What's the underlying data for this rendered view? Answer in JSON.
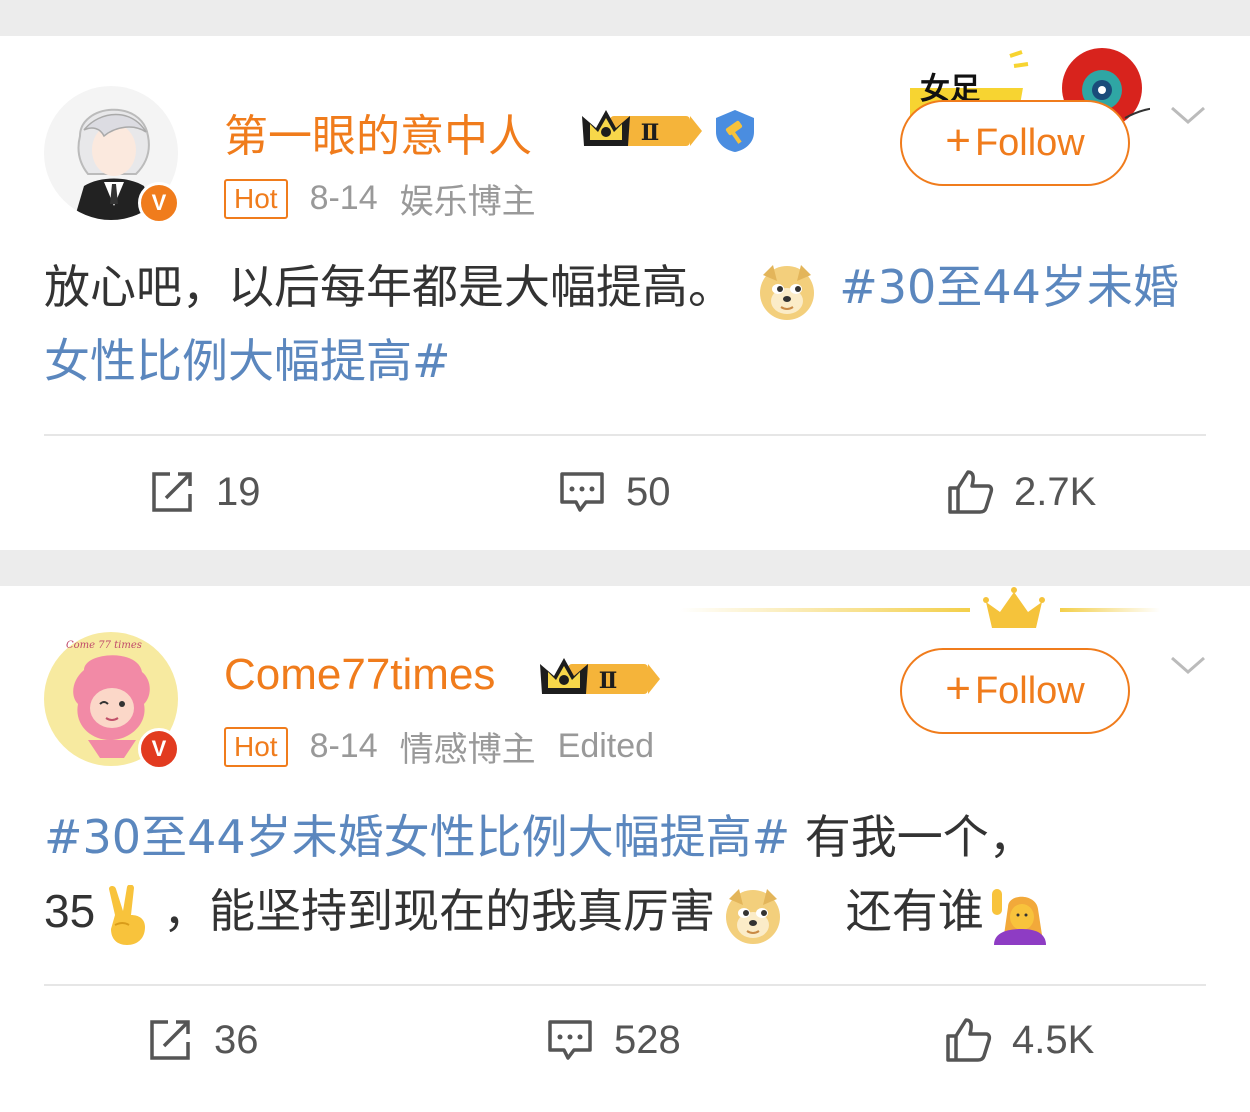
{
  "posts": [
    {
      "username": "第一眼的意中人",
      "level": "Ⅱ",
      "hot_label": "Hot",
      "date": "8-14",
      "category": "娱乐博主",
      "follow_label": "Follow",
      "content_text": "放心吧，以后每年都是大幅提高。",
      "hashtag": "#30至44岁未婚女性比例大幅提高#",
      "decor_text": "女足",
      "actions": {
        "repost": "19",
        "comment": "50",
        "like": "2.7K"
      },
      "verified_letter": "V"
    },
    {
      "username": "Come77times",
      "level": "Ⅱ",
      "hot_label": "Hot",
      "date": "8-14",
      "category": "情感博主",
      "edited": "Edited",
      "follow_label": "Follow",
      "hashtag": "#30至44岁未婚女性比例大幅提高#",
      "content_part1": "有我一个，",
      "content_part2": "35",
      "content_part3": "，能坚持到现在的我真厉害",
      "content_part4": "还有谁",
      "avatar_text": "Come 77 times",
      "actions": {
        "repost": "36",
        "comment": "528",
        "like": "4.5K"
      },
      "verified_letter": "V"
    }
  ],
  "colors": {
    "accent": "#f07c1c",
    "link": "#5b87be",
    "meta": "#999999"
  },
  "icons": [
    "crown-level-icon",
    "gov-gavel-icon",
    "doge-emoji-icon",
    "victory-hand-emoji-icon",
    "raising-hand-emoji-icon",
    "repost-icon",
    "comment-icon",
    "like-icon",
    "chevron-down-icon"
  ]
}
